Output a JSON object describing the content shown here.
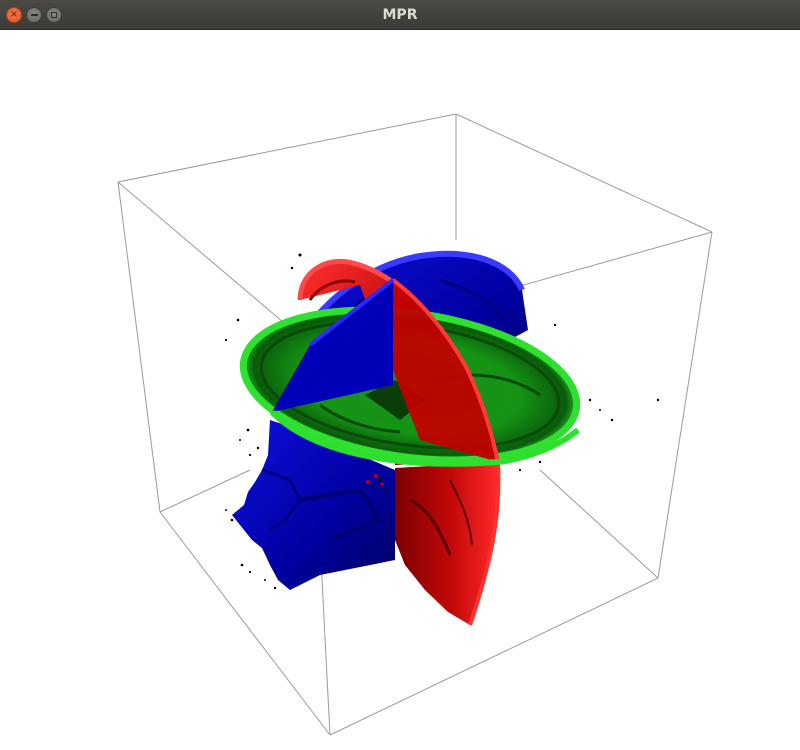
{
  "window": {
    "title": "MPR",
    "controls": {
      "close_icon": "close-icon",
      "minimize_icon": "minimize-icon",
      "maximize_icon": "maximize-icon"
    }
  },
  "viewport": {
    "background": "#ffffff",
    "planes": {
      "axial_color": "#00c000",
      "sagittal_color": "#d00000",
      "coronal_color": "#0000d0"
    },
    "bounding_box_color": "#9a9a9a"
  }
}
